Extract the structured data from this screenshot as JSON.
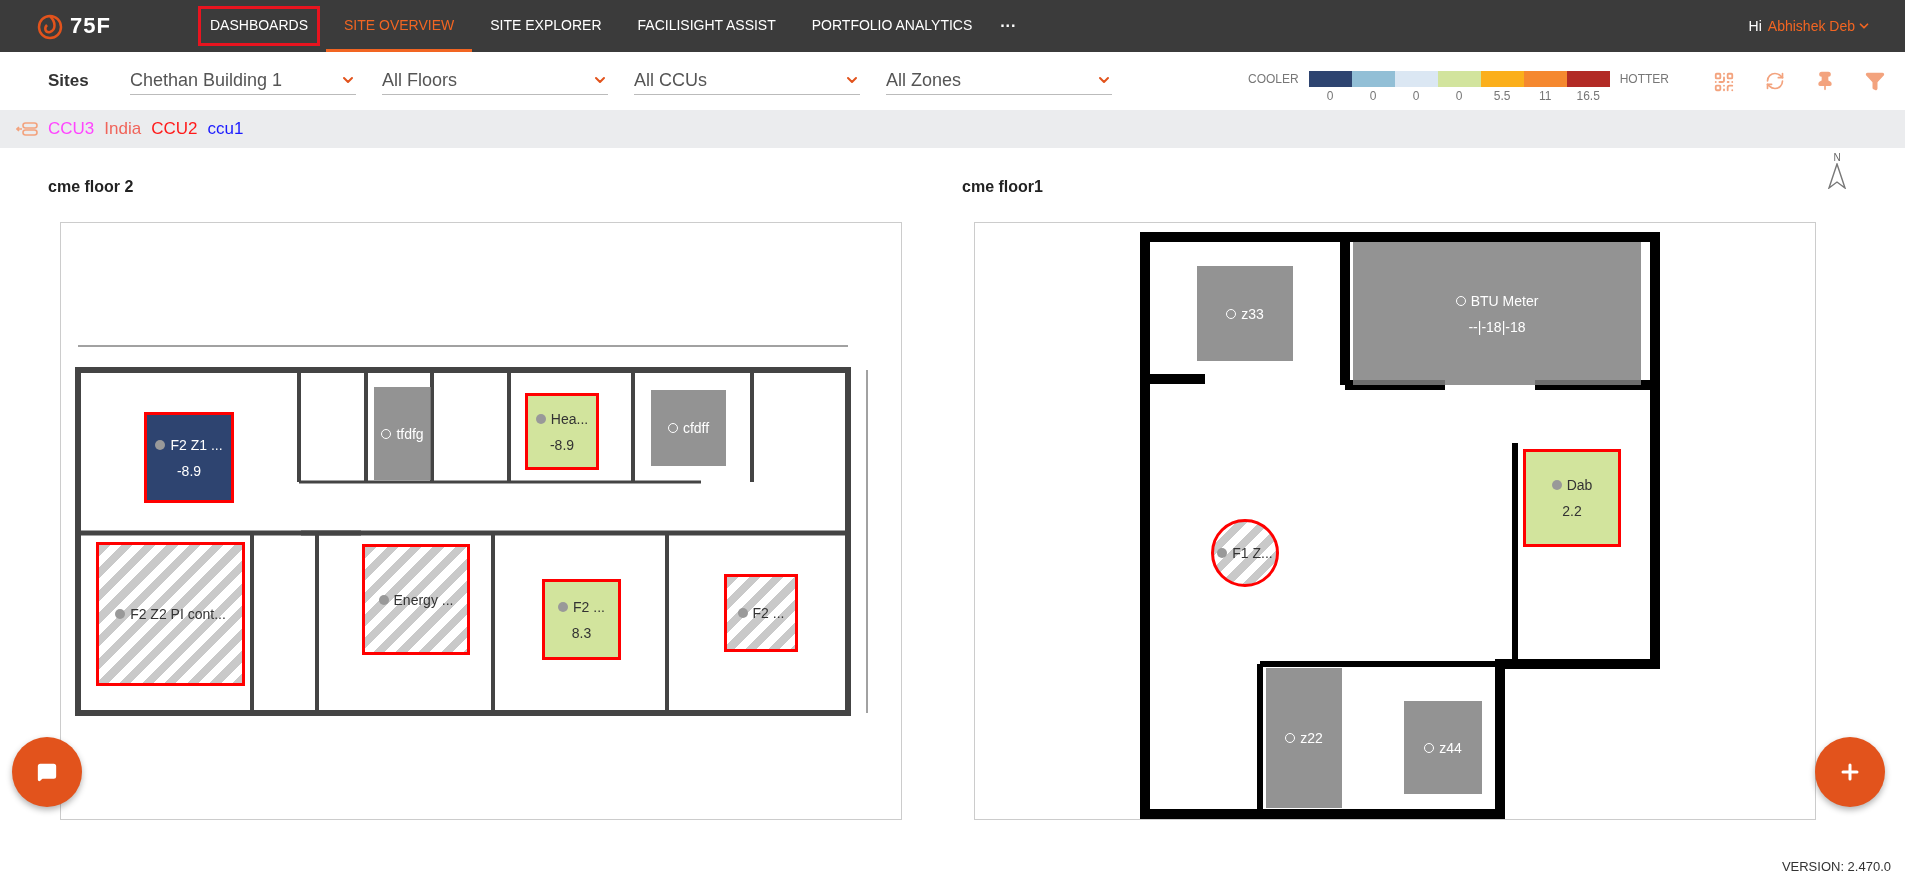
{
  "header": {
    "logo": "75F",
    "nav": [
      {
        "label": "DASHBOARDS",
        "selected": false,
        "highlighted": true
      },
      {
        "label": "SITE OVERVIEW",
        "selected": true,
        "highlighted": false
      },
      {
        "label": "SITE EXPLORER",
        "selected": false,
        "highlighted": false
      },
      {
        "label": "FACILISIGHT ASSIST",
        "selected": false,
        "highlighted": false
      },
      {
        "label": "PORTFOLIO ANALYTICS",
        "selected": false,
        "highlighted": false
      }
    ],
    "more": "···",
    "greeting": "Hi",
    "user": "Abhishek Deb"
  },
  "filters": {
    "label": "Sites",
    "dropdowns": [
      {
        "value": "Chethan Building 1"
      },
      {
        "value": "All Floors"
      },
      {
        "value": "All CCUs"
      },
      {
        "value": "All Zones"
      }
    ]
  },
  "legend": {
    "low": "COOLER",
    "high": "HOTTER",
    "segments": [
      {
        "color": "#2e4470",
        "label": "0"
      },
      {
        "color": "#92bfd6",
        "label": "0"
      },
      {
        "color": "#dbe7f3",
        "label": "0"
      },
      {
        "color": "#d2e49d",
        "label": "0"
      },
      {
        "color": "#fbaf1b",
        "label": "5.5"
      },
      {
        "color": "#f5882f",
        "label": "11"
      },
      {
        "color": "#b22a25",
        "label": "16.5"
      }
    ]
  },
  "ccus": [
    {
      "name": "CCU3",
      "color": "#ff44ff"
    },
    {
      "name": "India",
      "color": "#f0645a"
    },
    {
      "name": "CCU2",
      "color": "#ff1a1a"
    },
    {
      "name": "ccu1",
      "color": "#1a1aff"
    }
  ],
  "compass_label": "N",
  "floors": [
    {
      "title": "cme floor 2",
      "zones": [
        {
          "name": "F2 Z1 ...",
          "kind": "colored",
          "color": "#2e4470",
          "alert": true,
          "value": "-8.9"
        },
        {
          "name": "tfdfg",
          "kind": "offline",
          "alert": false
        },
        {
          "name": "Hea...",
          "kind": "colored",
          "color": "#d2e49d",
          "alert": true,
          "value": "-8.9"
        },
        {
          "name": "cfdff",
          "kind": "offline",
          "alert": false
        },
        {
          "name": "F2 Z2 PI cont...",
          "kind": "hatched",
          "alert": true
        },
        {
          "name": "Energy ...",
          "kind": "hatched",
          "alert": true
        },
        {
          "name": "F2 ...",
          "kind": "colored",
          "color": "#d2e49d",
          "alert": true,
          "value": "8.3"
        },
        {
          "name": "F2 ...",
          "kind": "hatched",
          "alert": true
        }
      ]
    },
    {
      "title": "cme floor1",
      "zones": [
        {
          "name": "z33",
          "kind": "offline",
          "alert": false
        },
        {
          "name": "BTU Meter",
          "kind": "offline",
          "alert": false,
          "value": "--|-18|-18"
        },
        {
          "name": "Dab",
          "kind": "colored",
          "color": "#d2e49d",
          "alert": true,
          "value": "2.2"
        },
        {
          "name": "F1 Z...",
          "kind": "hatched",
          "alert": true,
          "round": true
        },
        {
          "name": "z22",
          "kind": "offline",
          "alert": false
        },
        {
          "name": "z44",
          "kind": "offline",
          "alert": false
        }
      ]
    }
  ],
  "version": "VERSION: 2.470.0"
}
